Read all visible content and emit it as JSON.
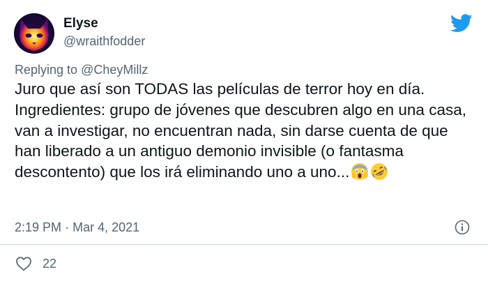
{
  "tweet": {
    "display_name": "Elyse",
    "handle": "@wraithfodder",
    "replying_prefix": "Replying to",
    "replying_to": "@CheyMillz",
    "text": "Juro que así son TODAS las películas de terror hoy en día. Ingredientes: grupo de jóvenes que descubren algo en una casa, van a investigar, no encuentran nada, sin darse cuenta de que han liberado a un antiguo demonio invisible (o fantasma descontento) que los irá eliminando uno a uno...",
    "emojis": [
      "face-screaming-in-fear",
      "rolling-on-the-floor-laughing"
    ],
    "time": "2:19 PM",
    "separator": "·",
    "date": "Mar 4, 2021",
    "like_count": "22"
  },
  "icons": {
    "brand": "twitter-bird-icon",
    "info": "info-icon",
    "like": "heart-icon"
  },
  "colors": {
    "twitter_blue": "#1d9bf0",
    "secondary_text": "#536471",
    "primary_text": "#0f1419",
    "divider": "#cfd9de"
  }
}
